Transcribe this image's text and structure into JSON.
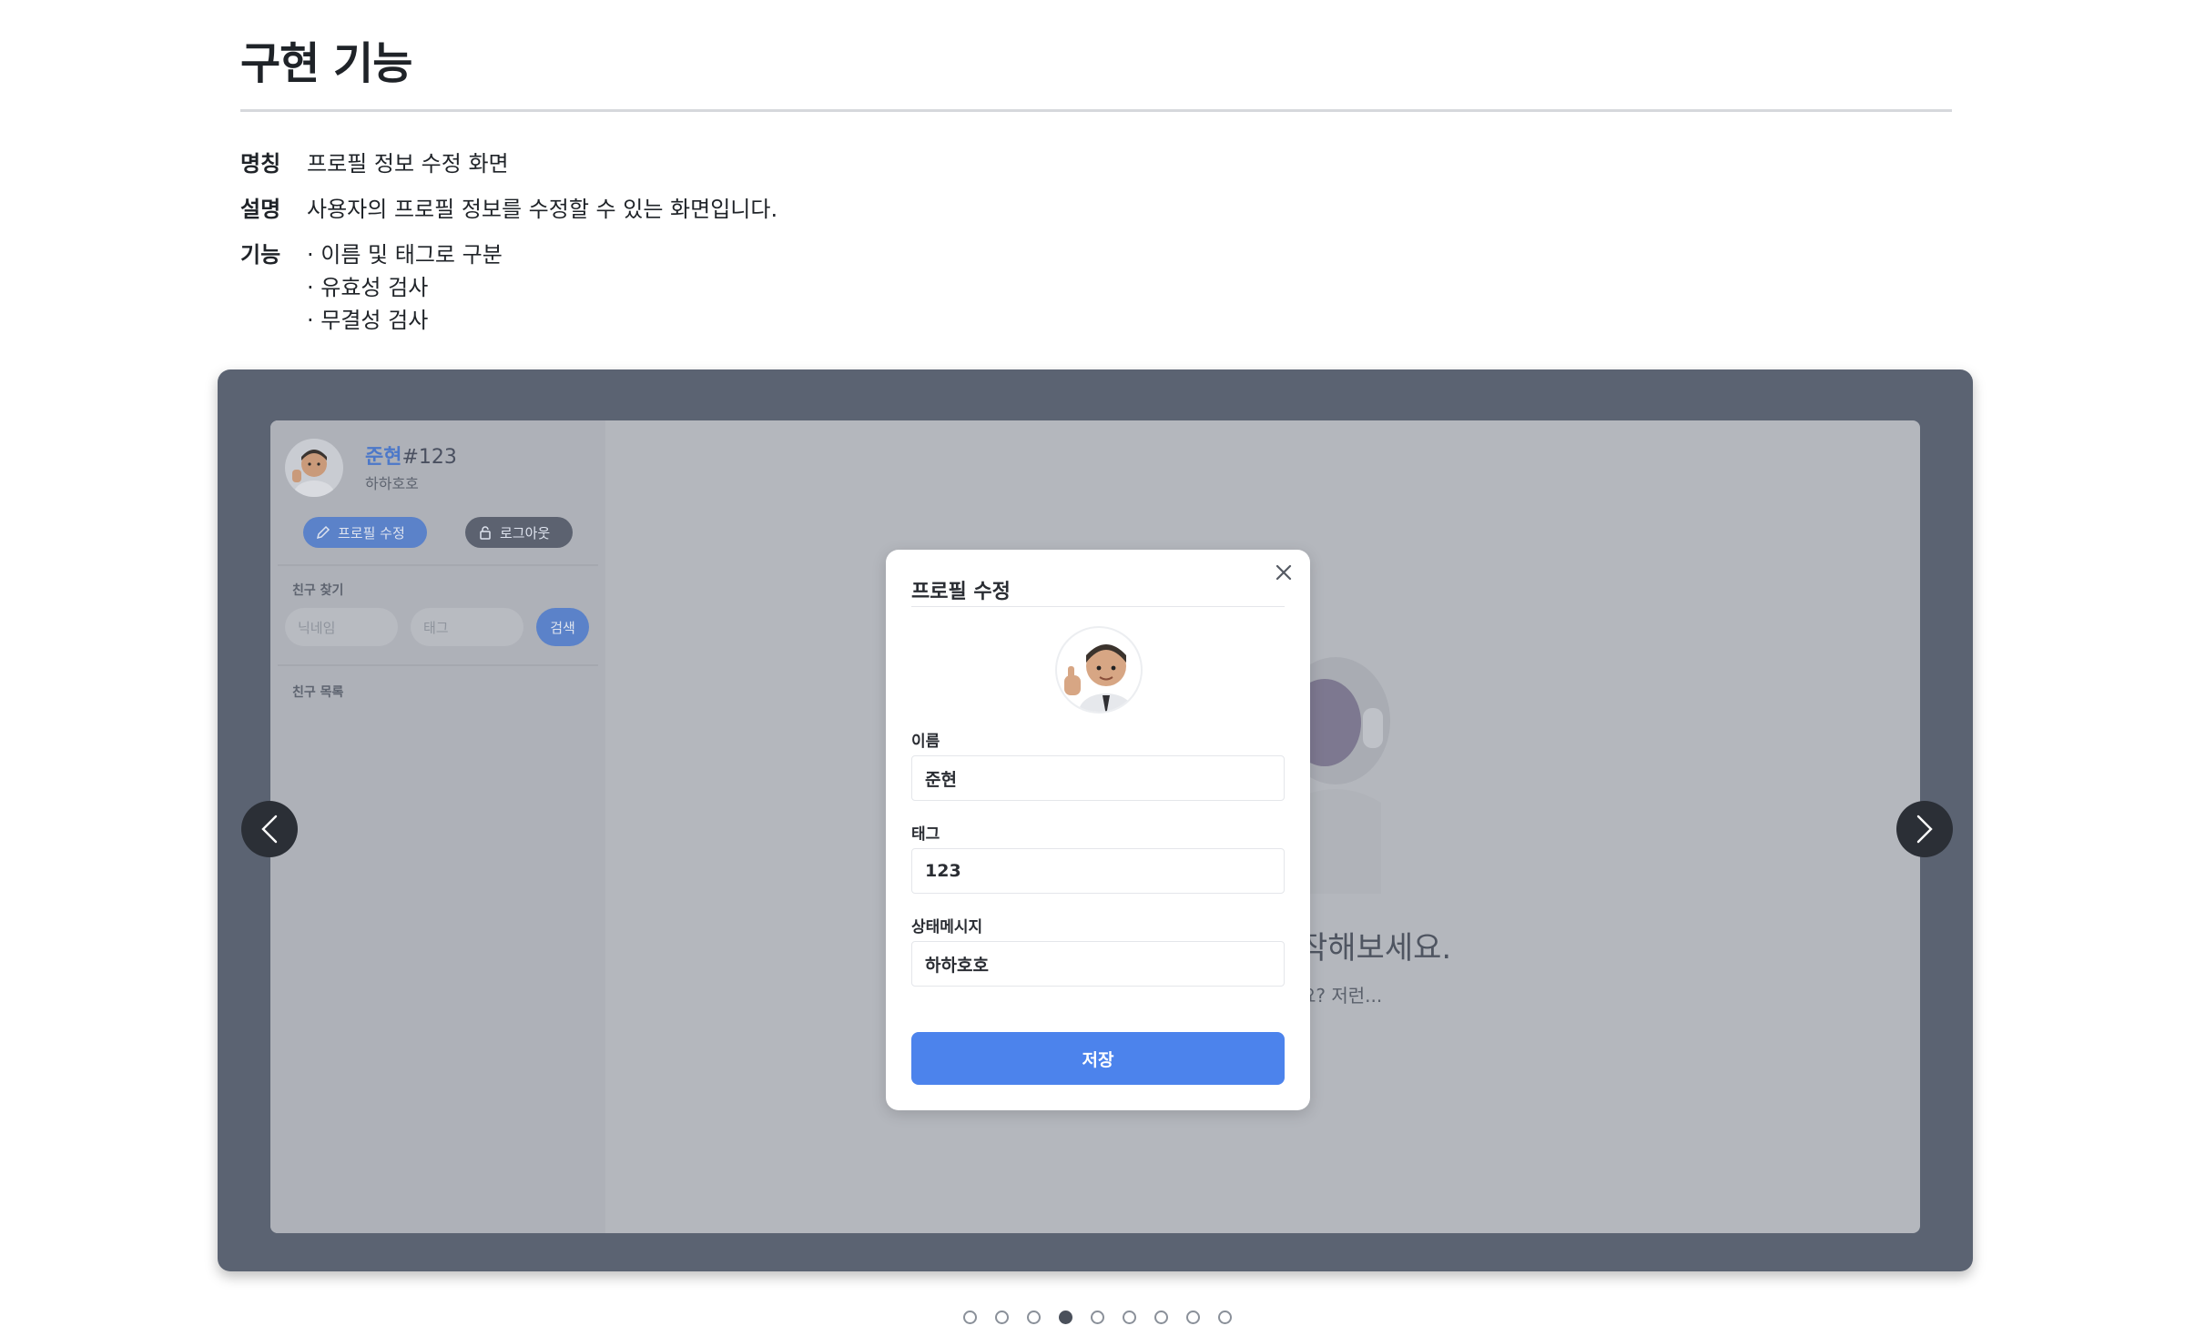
{
  "header": {
    "title": "구현 기능"
  },
  "info": {
    "name_label": "명칭",
    "name_value": "프로필 정보 수정 화면",
    "desc_label": "설명",
    "desc_value": "사용자의 프로필 정보를 수정할 수 있는 화면입니다.",
    "feature_label": "기능",
    "features": [
      "이름 및 태그로 구분",
      "유효성 검사",
      "무결성 검사"
    ]
  },
  "screenshot": {
    "sidebar": {
      "user_name": "준현",
      "user_tag": "#123",
      "status": "하하호호",
      "edit_profile": "프로필 수정",
      "logout": "로그아웃",
      "find_friends": "친구 찾기",
      "nickname_placeholder": "닉네임",
      "tag_placeholder": "태그",
      "search": "검색",
      "friend_list": "친구 목록"
    },
    "background": {
      "headline": "작해보세요.",
      "subline": "요? 저런..."
    },
    "modal": {
      "title": "프로필 수정",
      "name_label": "이름",
      "name_value": "준현",
      "tag_label": "태그",
      "tag_value": "123",
      "status_label": "상태메시지",
      "status_value": "하하호호",
      "save": "저장"
    }
  },
  "carousel": {
    "total": 9,
    "active_index": 3
  },
  "colors": {
    "accent": "#4c83ec",
    "frame": "#5b6372",
    "overlay": "#b4b7bd"
  }
}
